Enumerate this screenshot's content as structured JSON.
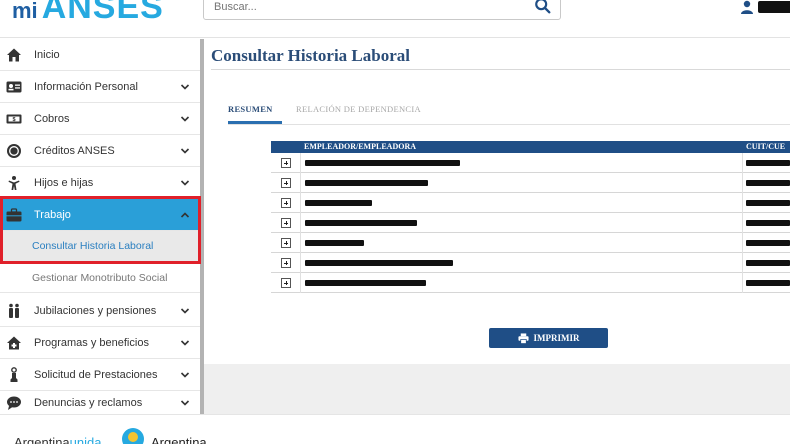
{
  "header": {
    "logo_mi": "mi",
    "logo_anses": "ANSES",
    "search_placeholder": "Buscar...",
    "user_name_redacted": true
  },
  "sidebar": {
    "items": [
      {
        "label": "Inicio",
        "icon": "home-icon"
      },
      {
        "label": "Información Personal",
        "icon": "id-card-icon"
      },
      {
        "label": "Cobros",
        "icon": "money-icon"
      },
      {
        "label": "Créditos ANSES",
        "icon": "coin-icon"
      },
      {
        "label": "Hijos e hijas",
        "icon": "child-icon"
      },
      {
        "label": "Trabajo",
        "icon": "briefcase-icon",
        "active": true
      },
      {
        "label": "Jubilaciones y pensiones",
        "icon": "elderly-icon"
      },
      {
        "label": "Programas y beneficios",
        "icon": "house-plus-icon"
      },
      {
        "label": "Solicitud de Prestaciones",
        "icon": "hand-icon"
      },
      {
        "label": "Denuncias y reclamos",
        "icon": "speech-bubble-icon"
      }
    ],
    "sub_items": [
      {
        "label": "Consultar Historia Laboral",
        "selected": true
      },
      {
        "label": "Gestionar Monotributo Social"
      }
    ]
  },
  "main": {
    "title": "Consultar Historia Laboral",
    "tabs": [
      {
        "label": "RESUMEN",
        "active": true
      },
      {
        "label": "RELACIÓN DE DEPENDENCIA",
        "active": false
      }
    ],
    "table": {
      "headers": [
        "EMPLEADOR/EMPLEADORA",
        "CUIT/CUE"
      ],
      "rows_redacted": 7
    },
    "print_button": "IMPRIMIR"
  },
  "footer": {
    "brand_part1": "Argentina",
    "brand_part2": "unida",
    "brand_right": "Argentina"
  },
  "colors": {
    "accent": "#2a9fd8",
    "header_blue": "#1f4e86",
    "highlight_red": "#e0202a",
    "logo_blue": "#26a9e0"
  }
}
